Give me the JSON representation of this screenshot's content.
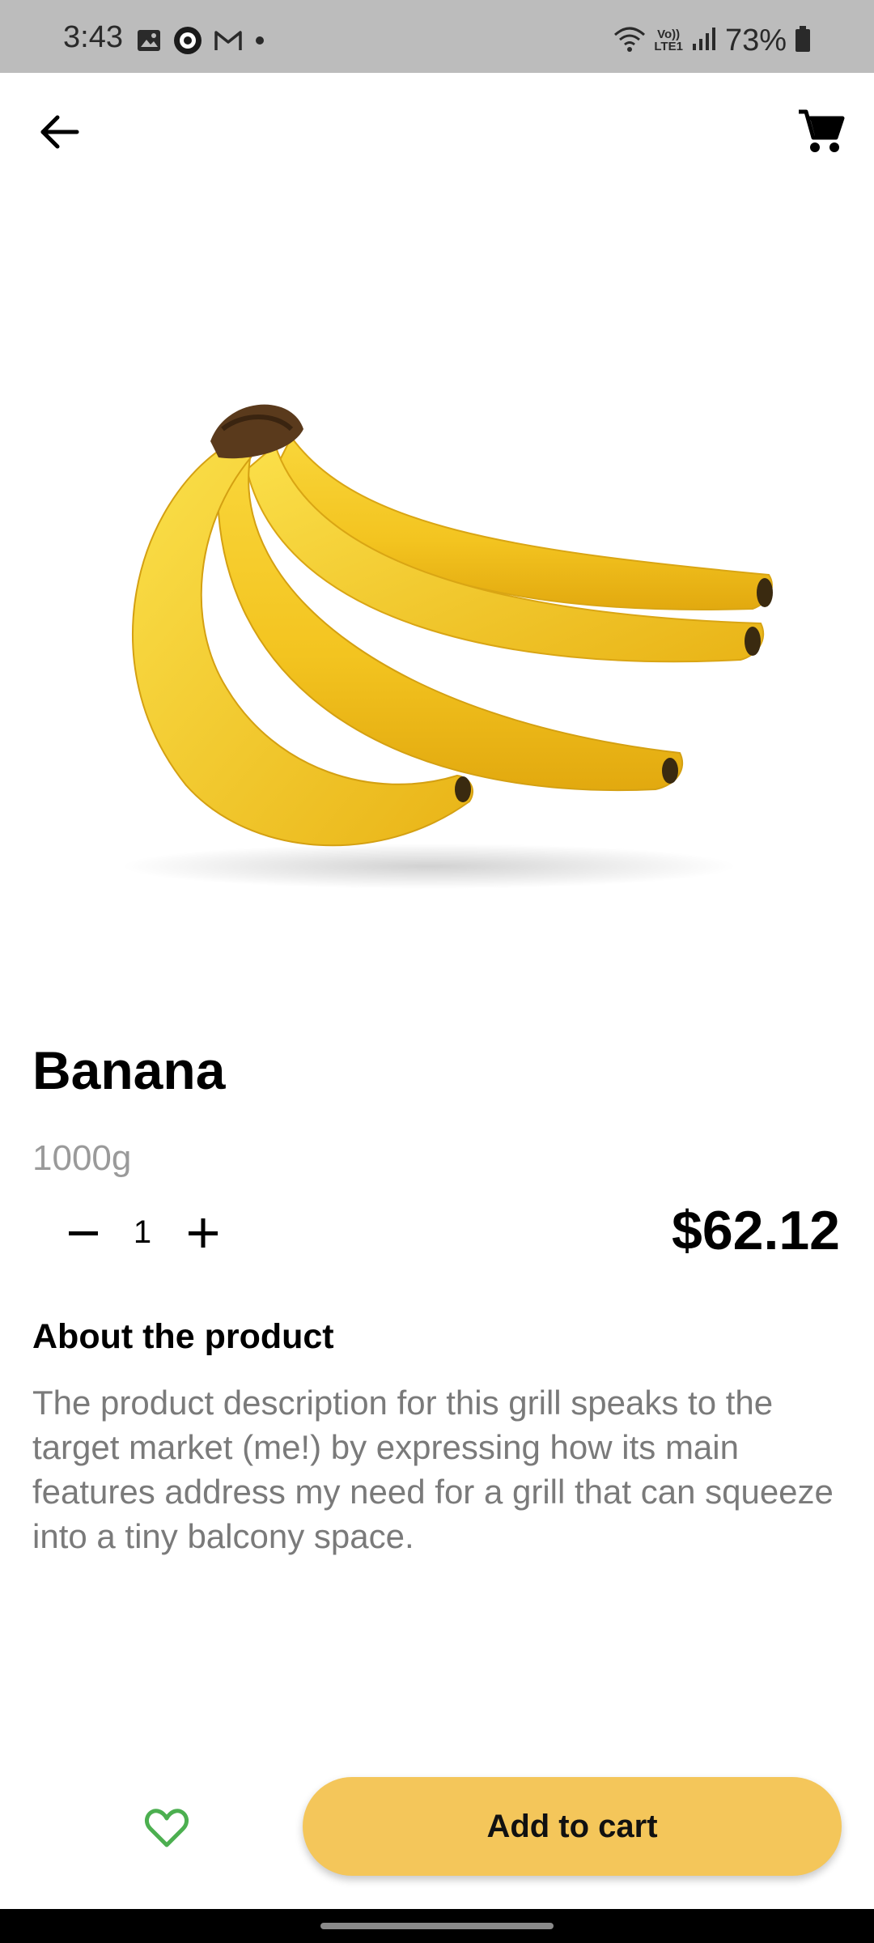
{
  "status_bar": {
    "time": "3:43",
    "battery": "73%",
    "volte_line1": "Vo))",
    "volte_line2": "LTE1",
    "icons": [
      "image-icon",
      "app-icon",
      "gmail-icon",
      "dot-icon",
      "wifi-icon",
      "signal-icon",
      "battery-icon"
    ]
  },
  "app_bar": {
    "back_icon": "arrow-left-icon",
    "cart_icon": "shopping-cart-icon"
  },
  "product": {
    "image_alt": "banana-image",
    "title": "Banana",
    "weight": "1000g",
    "quantity": "1",
    "price": "$62.12",
    "about_heading": "About the product",
    "about_text": "The product description for this grill speaks to the target market (me!) by expressing how its main features address my need for a grill that can squeeze into a tiny balcony space."
  },
  "actions": {
    "favorite_icon": "heart-icon",
    "add_to_cart_label": "Add to cart"
  },
  "colors": {
    "accent": "#f4c65a",
    "favorite": "#4caf50",
    "status_bar_bg": "#bcbcbc",
    "muted_text": "#9a9a9a"
  }
}
